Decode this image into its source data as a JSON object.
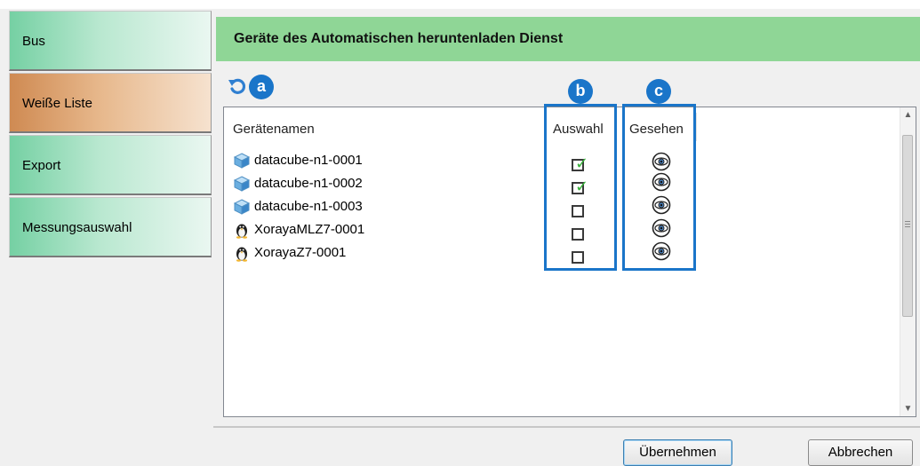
{
  "sidebar": {
    "items": [
      {
        "label": "Bus",
        "active": false
      },
      {
        "label": "Weiße Liste",
        "active": true
      },
      {
        "label": "Export",
        "active": false
      },
      {
        "label": "Messungsauswahl",
        "active": false
      }
    ]
  },
  "panel": {
    "title": "Geräte des Automatischen heruntenladen Dienst"
  },
  "callouts": {
    "a": "a",
    "b": "b",
    "c": "c"
  },
  "list": {
    "columns": {
      "name": "Gerätenamen",
      "selection": "Auswahl",
      "seen": "Gesehen"
    },
    "rows": [
      {
        "name": "datacube-n1-0001",
        "icon": "cube-icon",
        "selected": true
      },
      {
        "name": "datacube-n1-0002",
        "icon": "cube-icon",
        "selected": true
      },
      {
        "name": "datacube-n1-0003",
        "icon": "cube-icon",
        "selected": false
      },
      {
        "name": "XorayaMLZ7-0001",
        "icon": "linux-penguin-icon",
        "selected": false
      },
      {
        "name": "XorayaZ7-0001",
        "icon": "linux-penguin-icon",
        "selected": false
      }
    ]
  },
  "buttons": {
    "apply": "Übernehmen",
    "cancel": "Abbrechen"
  },
  "colors": {
    "header": "#8fd696",
    "callout": "#1a75c9",
    "active_tab": "#cf8a52",
    "tab": "#75d0a3"
  }
}
